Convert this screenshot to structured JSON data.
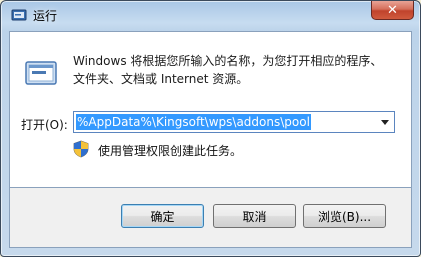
{
  "window": {
    "title": "运行",
    "icons": {
      "app": "run-app-icon",
      "close": "close-icon"
    },
    "close_glyph": "✕"
  },
  "main": {
    "icon": "run-icon",
    "description_line1": "Windows 将根据您所输入的名称，为您打开相应的程序、",
    "description_line2": "文件夹、文档或 Internet 资源。",
    "open_label": "打开(O):",
    "command_value": "%AppData%\\Kingsoft\\wps\\addons\\pool",
    "admin_text": "使用管理权限创建此任务。",
    "shield_icon": "uac-shield-icon"
  },
  "buttons": {
    "ok": "确定",
    "cancel": "取消",
    "browse": "浏览(B)..."
  },
  "colors": {
    "selection": "#3399ff",
    "close_red": "#c0432c",
    "frame_blue": "#bcd3ea"
  }
}
